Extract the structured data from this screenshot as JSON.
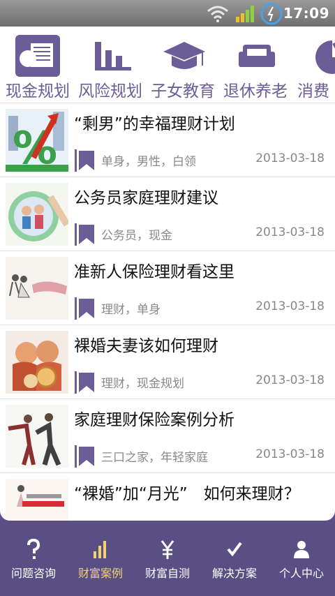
{
  "status_bar": {
    "time": "17:09"
  },
  "categories": [
    {
      "label": "现金规划",
      "icon": "cash-planning-icon",
      "active": true
    },
    {
      "label": "风险规划",
      "icon": "bar-chart-icon"
    },
    {
      "label": "子女教育",
      "icon": "graduation-cap-icon"
    },
    {
      "label": "退休养老",
      "icon": "sofa-icon"
    },
    {
      "label": "消费",
      "icon": "pie-chart-icon"
    }
  ],
  "articles": [
    {
      "title": "“剩男”的幸福理财计划",
      "tags": "单身，男性，白领",
      "date": "2013-03-18"
    },
    {
      "title": "公务员家庭理财建议",
      "tags": "公务员，现金",
      "date": "2013-03-18"
    },
    {
      "title": "准新人保险理财看这里",
      "tags": "理财，单身",
      "date": "2013-03-18"
    },
    {
      "title": "裸婚夫妻该如何理财",
      "tags": "理财，现金规划",
      "date": "2013-03-18"
    },
    {
      "title": "家庭理财保险案例分析",
      "tags": "三口之家，年轻家庭",
      "date": "2013-03-18"
    },
    {
      "title": "“裸婚”加“月光”　如何来理财？",
      "tags": "",
      "date": ""
    }
  ],
  "bottom_nav": [
    {
      "label": "问题咨询",
      "icon": "question-icon"
    },
    {
      "label": "财富案例",
      "icon": "bar-chart-icon",
      "active": true
    },
    {
      "label": "财富自测",
      "icon": "yen-icon"
    },
    {
      "label": "解决方案",
      "icon": "check-icon"
    },
    {
      "label": "个人中心",
      "icon": "person-icon"
    }
  ],
  "colors": {
    "accent": "#6b5e98",
    "nav_bg": "#5a4f85",
    "nav_active": "#f2d36b"
  }
}
